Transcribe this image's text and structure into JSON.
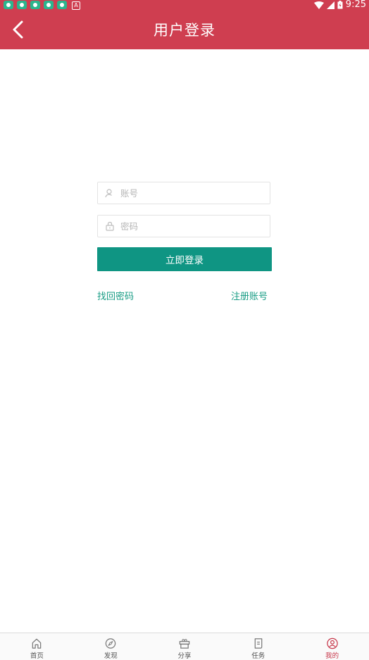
{
  "status_bar": {
    "time": "9:25",
    "badge": "A",
    "notification_icons": [
      "app-icon",
      "app-icon",
      "app-icon",
      "app-icon",
      "app-icon"
    ]
  },
  "header": {
    "title": "用户登录",
    "back_icon": "chevron-left-icon"
  },
  "form": {
    "account_placeholder": "账号",
    "account_value": "",
    "password_placeholder": "密码",
    "password_value": "",
    "login_label": "立即登录",
    "forgot_label": "找回密码",
    "register_label": "注册账号"
  },
  "tabbar": {
    "items": [
      {
        "label": "首页",
        "icon": "home-icon"
      },
      {
        "label": "发现",
        "icon": "compass-icon"
      },
      {
        "label": "分享",
        "icon": "gift-box-icon"
      },
      {
        "label": "任务",
        "icon": "task-icon"
      },
      {
        "label": "我的",
        "icon": "profile-icon"
      }
    ],
    "active": "我的"
  },
  "colors": {
    "brand": "#cf3e50",
    "primary_button": "#0f9583",
    "link": "#179c84",
    "active_tab": "#c7374a"
  }
}
